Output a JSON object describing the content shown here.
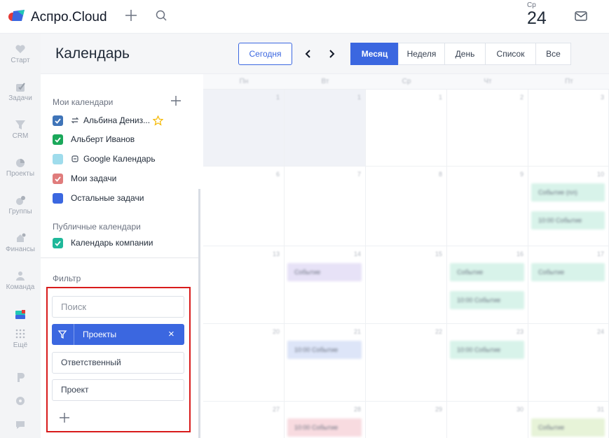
{
  "app": {
    "name": "Аспро.Cloud"
  },
  "topbar": {
    "date_day": "Ср",
    "date_num": "24"
  },
  "rail": [
    {
      "label": "Старт",
      "icon": "heart-icon"
    },
    {
      "label": "Задачи",
      "icon": "check-icon"
    },
    {
      "label": "CRM",
      "icon": "funnel-icon"
    },
    {
      "label": "Проекты",
      "icon": "pie-icon"
    },
    {
      "label": "Группы",
      "icon": "groups-icon"
    },
    {
      "label": "Финансы",
      "icon": "finance-icon"
    },
    {
      "label": "Команда",
      "icon": "team-icon"
    },
    {
      "label": "",
      "icon": "calendar-app-icon"
    },
    {
      "label": "Ещё",
      "icon": "grid-icon"
    }
  ],
  "header": {
    "title": "Календарь",
    "today": "Сегодня",
    "views": [
      "Месяц",
      "Неделя",
      "День",
      "Список",
      "Все"
    ],
    "active_view": "Месяц"
  },
  "sidebar": {
    "my_title": "Мои календари",
    "my": [
      {
        "label": "Альбина Дениз...",
        "color": "#3f74b8"
      },
      {
        "label": "Альберт Иванов",
        "color": "#1aa85a"
      },
      {
        "label": "Google Календарь",
        "color": "#9fdcec"
      },
      {
        "label": "Мои задачи",
        "color": "#e07c7c"
      },
      {
        "label": "Остальные задачи",
        "color": "#3b67e0"
      }
    ],
    "public_title": "Публичные календари",
    "public": [
      {
        "label": "Календарь компании",
        "color": "#1fb89a"
      }
    ],
    "filter_title": "Фильтр",
    "filter": {
      "search_placeholder": "Поиск",
      "chip": "Проекты",
      "chip_close": "×",
      "responsible": "Ответственный",
      "project": "Проект"
    }
  },
  "calendar": {
    "weekdays": [
      "Пн",
      "Вт",
      "Ср",
      "Чт",
      "Пт"
    ],
    "days": [
      [
        "1",
        "1",
        "1",
        "2",
        "3"
      ],
      [
        "6",
        "7",
        "8",
        "9",
        "10"
      ],
      [
        "13",
        "14",
        "15",
        "16",
        "17"
      ],
      [
        "20",
        "21",
        "22",
        "23",
        "24"
      ],
      [
        "27",
        "28",
        "29",
        "30",
        "31"
      ]
    ],
    "events": [
      {
        "row": 1,
        "col": 4,
        "slot": 0,
        "text": "Событие (пл)",
        "color": "#d8f3ea"
      },
      {
        "row": 1,
        "col": 4,
        "slot": 1,
        "text": "10:00 Событие",
        "color": "#d8f3ea"
      },
      {
        "row": 2,
        "col": 1,
        "slot": 0,
        "text": "Событие",
        "color": "#e7e2f7"
      },
      {
        "row": 2,
        "col": 3,
        "slot": 0,
        "text": "Событие",
        "color": "#d8f3ea"
      },
      {
        "row": 2,
        "col": 4,
        "slot": 0,
        "text": "Событие",
        "color": "#d8f3ea"
      },
      {
        "row": 2,
        "col": 3,
        "slot": 1,
        "text": "10:00 Событие",
        "color": "#d8f3ea"
      },
      {
        "row": 3,
        "col": 1,
        "slot": 0,
        "text": "10:00 Событие",
        "color": "#dde5f8"
      },
      {
        "row": 3,
        "col": 3,
        "slot": 0,
        "text": "10:00 Событие",
        "color": "#d8f3ea"
      },
      {
        "row": 4,
        "col": 1,
        "slot": 0,
        "text": "10:00 Событие",
        "color": "#f8dbe0"
      },
      {
        "row": 4,
        "col": 4,
        "slot": 0,
        "text": "Событие",
        "color": "#e7f3d8"
      }
    ]
  }
}
